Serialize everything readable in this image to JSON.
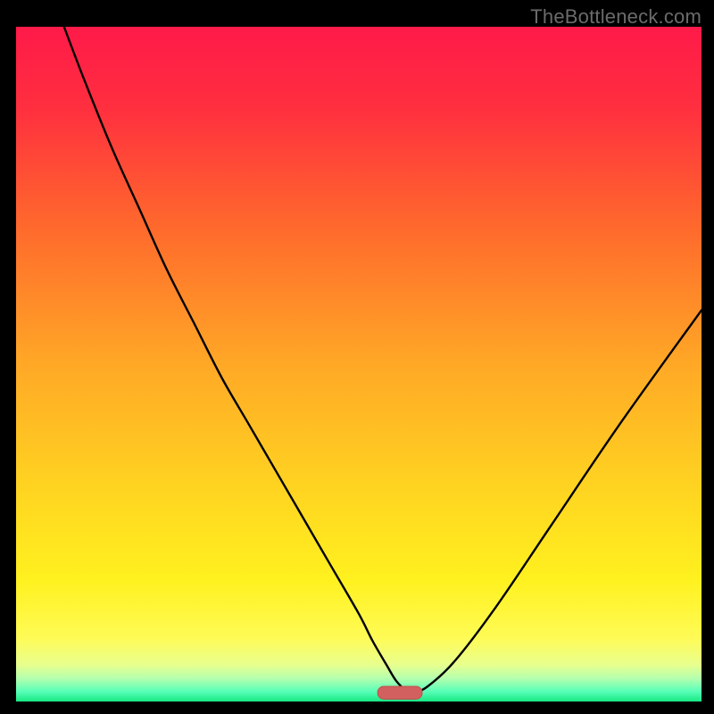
{
  "watermark": "TheBottleneck.com",
  "colors": {
    "frame": "#000000",
    "watermark": "#6b6b6b",
    "gradient_stops": [
      {
        "offset": 0.0,
        "color": "#ff1a49"
      },
      {
        "offset": 0.12,
        "color": "#ff2f3f"
      },
      {
        "offset": 0.3,
        "color": "#ff6a2c"
      },
      {
        "offset": 0.5,
        "color": "#ffa826"
      },
      {
        "offset": 0.68,
        "color": "#ffd321"
      },
      {
        "offset": 0.82,
        "color": "#fff11f"
      },
      {
        "offset": 0.905,
        "color": "#fffb55"
      },
      {
        "offset": 0.945,
        "color": "#e9ff8d"
      },
      {
        "offset": 0.965,
        "color": "#b6ffad"
      },
      {
        "offset": 0.985,
        "color": "#59ffb8"
      },
      {
        "offset": 1.0,
        "color": "#17e884"
      }
    ],
    "curve": "#000000",
    "marker_fill": "#d1605e",
    "marker_stroke": "#c24f4d"
  },
  "chart_data": {
    "type": "line",
    "title": "",
    "xlabel": "",
    "ylabel": "",
    "xlim": [
      0,
      100
    ],
    "ylim": [
      0,
      100
    ],
    "grid": false,
    "legend": false,
    "series": [
      {
        "name": "bottleneck-curve",
        "x": [
          7,
          10,
          14,
          18,
          22,
          26,
          30,
          34,
          38,
          42,
          46,
          50,
          52,
          54,
          55.5,
          57,
          58,
          60,
          64,
          70,
          78,
          88,
          100
        ],
        "values": [
          100,
          92,
          82,
          73,
          64,
          56,
          48,
          41,
          34,
          27,
          20,
          13,
          9,
          5.5,
          3,
          1.6,
          1.4,
          2.2,
          6,
          14,
          26,
          41,
          58
        ]
      }
    ],
    "marker": {
      "name": "optimal-range",
      "x_center": 56,
      "y": 1.3,
      "width": 6.5,
      "height": 1.9
    }
  }
}
